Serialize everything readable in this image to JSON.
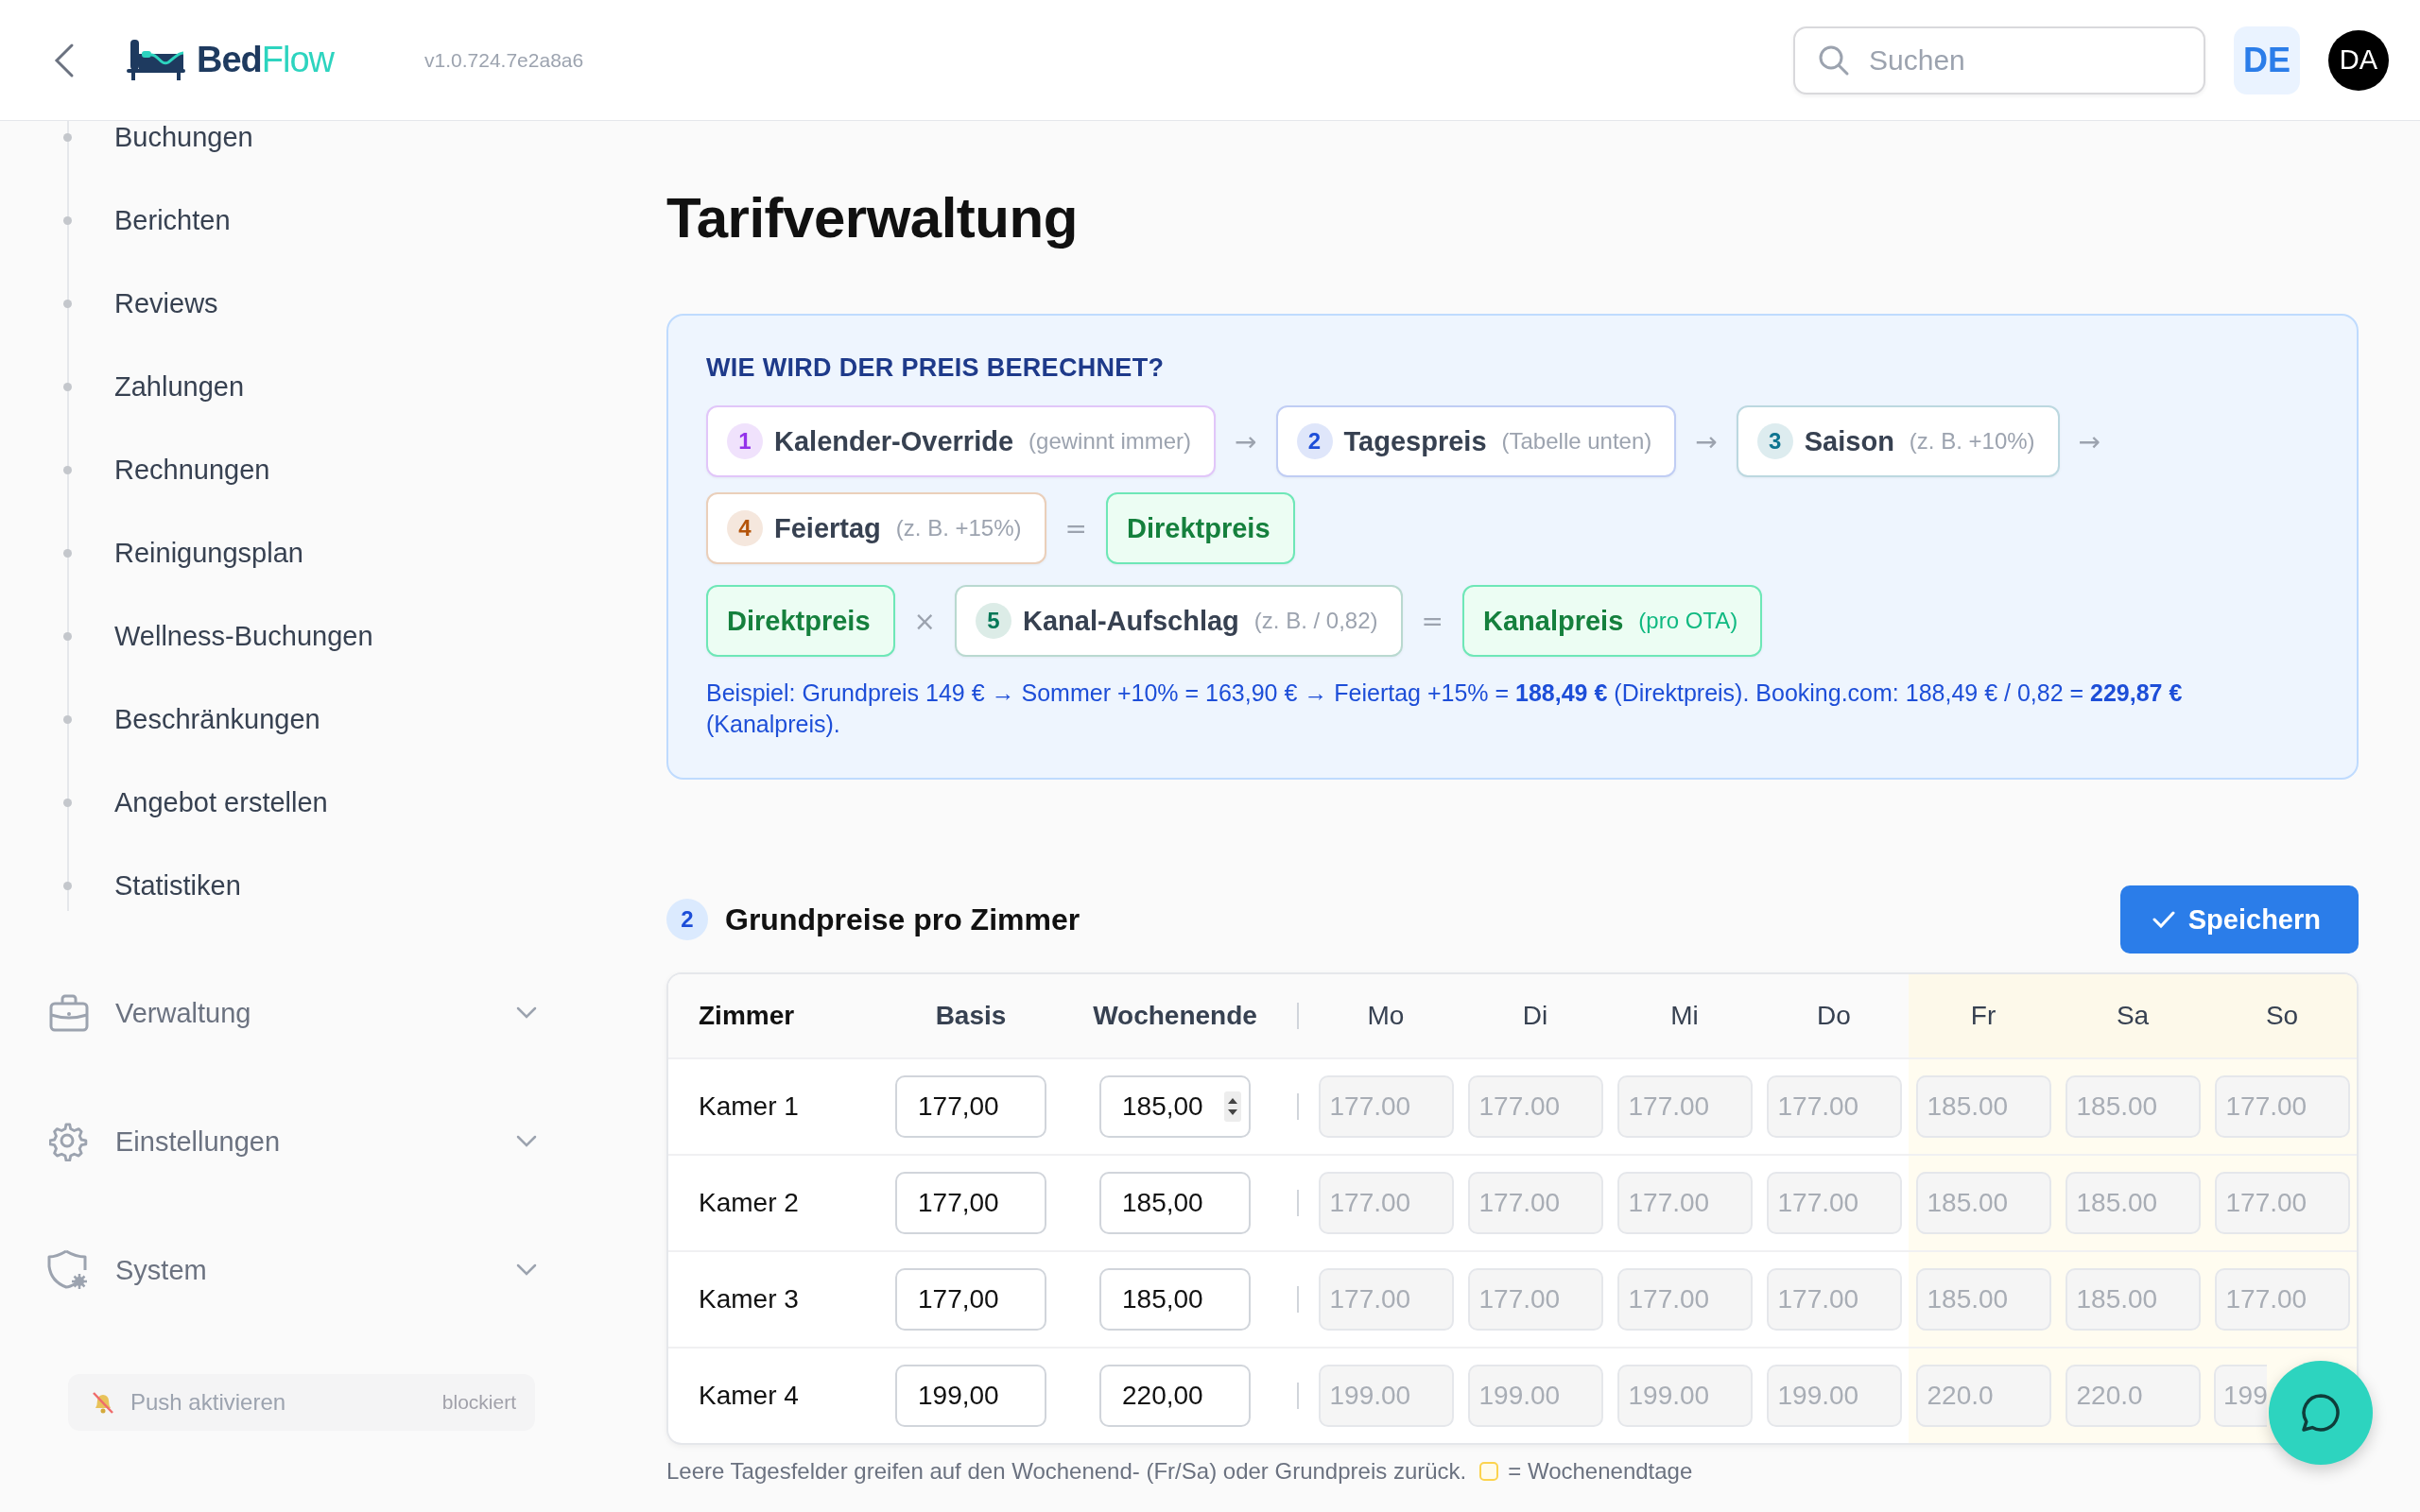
{
  "header": {
    "logo": {
      "first": "Bed",
      "second": "Flow"
    },
    "version": "v1.0.724.7e2a8a6",
    "search": {
      "placeholder": "Suchen"
    },
    "language": "DE",
    "avatar": "DA"
  },
  "sidebar": {
    "items": [
      {
        "label": "Buchungen"
      },
      {
        "label": "Berichten"
      },
      {
        "label": "Reviews"
      },
      {
        "label": "Zahlungen"
      },
      {
        "label": "Rechnungen"
      },
      {
        "label": "Reinigungsplan"
      },
      {
        "label": "Wellness-Buchungen"
      },
      {
        "label": "Beschränkungen"
      },
      {
        "label": "Angebot erstellen"
      },
      {
        "label": "Statistiken"
      }
    ],
    "groups": [
      {
        "label": "Verwaltung",
        "expanded": false
      },
      {
        "label": "Einstellungen",
        "expanded": false
      },
      {
        "label": "System",
        "expanded": false
      }
    ],
    "push": {
      "label": "Push aktivieren",
      "status": "blockiert"
    }
  },
  "page_title": "Tarifverwaltung",
  "info": {
    "title": "WIE WIRD DER PREIS BERECHNET?",
    "lines": [
      {
        "items": [
          {
            "kind": "step",
            "number": "1",
            "label": "Kalender-Override",
            "hint": "(gewinnt immer)",
            "color": "#9333ea"
          },
          {
            "kind": "op",
            "symbol": "→"
          },
          {
            "kind": "step",
            "number": "2",
            "label": "Tagespreis",
            "hint": "(Tabelle unten)",
            "color": "#1d4ed8"
          },
          {
            "kind": "op",
            "symbol": "→"
          },
          {
            "kind": "step",
            "number": "3",
            "label": "Saison",
            "hint": "(z. B. +10%)",
            "color": "#0e7490"
          },
          {
            "kind": "op",
            "symbol": "→"
          }
        ]
      },
      {
        "items": [
          {
            "kind": "step",
            "number": "4",
            "label": "Feiertag",
            "hint": "(z. B. +15%)",
            "color": "#b45309"
          },
          {
            "kind": "op",
            "symbol": "="
          },
          {
            "kind": "result",
            "label": "Direktpreis"
          }
        ]
      },
      {
        "items": [
          {
            "kind": "result",
            "label": "Direktpreis"
          },
          {
            "kind": "op",
            "symbol": "×"
          },
          {
            "kind": "step",
            "number": "5",
            "label": "Kanal-Aufschlag",
            "hint": "(z. B. / 0,82)",
            "color": "#047857"
          },
          {
            "kind": "op",
            "symbol": "="
          },
          {
            "kind": "result",
            "label": "Kanalpreis",
            "hint": "(pro OTA)"
          }
        ]
      }
    ],
    "example": "Beispiel: Grundpreis 149 € → Sommer +10% = 163,90 € → Feiertag +15% = **188,49 €** (Direktpreis). Booking.com: 188,49 € / 0,82 = **229,87 €** (Kanalpreis)."
  },
  "section": {
    "number": "2",
    "title": "Grundpreise pro Zimmer",
    "save_button": "Speichern"
  },
  "table": {
    "columns": [
      {
        "label": "Zimmer",
        "kind": "name"
      },
      {
        "label": "Basis",
        "kind": "base"
      },
      {
        "label": "Wochenende",
        "kind": "base"
      },
      {
        "label": "Mo",
        "kind": "day",
        "weekend": false
      },
      {
        "label": "Di",
        "kind": "day",
        "weekend": false
      },
      {
        "label": "Mi",
        "kind": "day",
        "weekend": false
      },
      {
        "label": "Do",
        "kind": "day",
        "weekend": false
      },
      {
        "label": "Fr",
        "kind": "day",
        "weekend": true
      },
      {
        "label": "Sa",
        "kind": "day",
        "weekend": true
      },
      {
        "label": "So",
        "kind": "day",
        "weekend": true
      }
    ],
    "rows": [
      {
        "room": "Kamer 1",
        "base": "177,00",
        "weekend": "185,00",
        "spinner": true,
        "placeholders": [
          "177.00",
          "177.00",
          "177.00",
          "177.00",
          "185.00",
          "185.00",
          "177.00"
        ]
      },
      {
        "room": "Kamer 2",
        "base": "177,00",
        "weekend": "185,00",
        "spinner": false,
        "placeholders": [
          "177.00",
          "177.00",
          "177.00",
          "177.00",
          "185.00",
          "185.00",
          "177.00"
        ]
      },
      {
        "room": "Kamer 3",
        "base": "177,00",
        "weekend": "185,00",
        "spinner": false,
        "placeholders": [
          "177.00",
          "177.00",
          "177.00",
          "177.00",
          "185.00",
          "185.00",
          "177.00"
        ]
      },
      {
        "room": "Kamer 4",
        "base": "199,00",
        "weekend": "220,00",
        "spinner": false,
        "placeholders": [
          "199.00",
          "199.00",
          "199.00",
          "199.00",
          "220.0",
          "220.0",
          "199"
        ]
      }
    ]
  },
  "footnote": {
    "text": "Leere Tagesfelder greifen auf den Wochenend- (Fr/Sa) oder Grundpreis zurück.",
    "legend": "= Wochenendtage"
  }
}
